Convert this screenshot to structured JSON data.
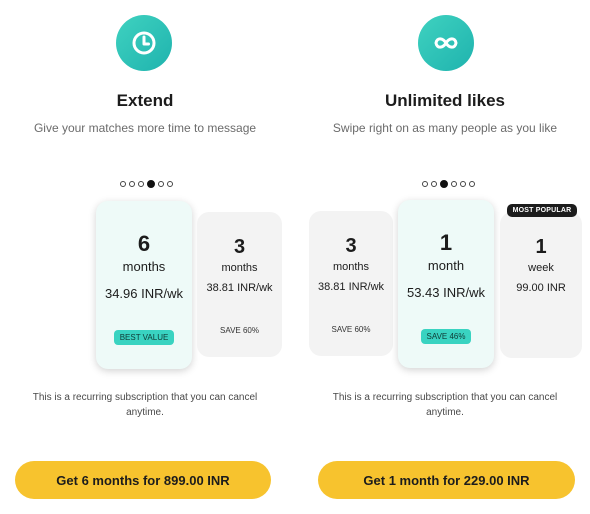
{
  "extend": {
    "icon": "clock-icon",
    "title": "Extend",
    "subtitle": "Give your matches more time to message",
    "plans": [
      {
        "qty": "6",
        "unit": "months",
        "price": "34.96 INR/wk",
        "badge": "BEST VALUE",
        "selected": true
      },
      {
        "qty": "3",
        "unit": "months",
        "price": "38.81 INR/wk",
        "badge": "SAVE 60%",
        "selected": false
      }
    ],
    "disclaimer": "This is a recurring subscription that you can cancel anytime.",
    "cta": "Get 6 months for 899.00 INR"
  },
  "unlimited": {
    "icon": "infinity-icon",
    "title": "Unlimited likes",
    "subtitle": "Swipe right on as many people as you like",
    "popular_tag": "MOST POPULAR",
    "plans": [
      {
        "qty": "3",
        "unit": "months",
        "price": "38.81 INR/wk",
        "badge": "SAVE 60%",
        "selected": false
      },
      {
        "qty": "1",
        "unit": "month",
        "price": "53.43 INR/wk",
        "badge": "SAVE 46%",
        "selected": true
      },
      {
        "qty": "1",
        "unit": "week",
        "price": "99.00 INR",
        "badge": "",
        "selected": false
      }
    ],
    "disclaimer": "This is a recurring subscription that you can cancel anytime.",
    "cta": "Get 1 month for 229.00 INR"
  },
  "colors": {
    "accent_teal": "#39d3c1",
    "cta_yellow": "#f7c32e",
    "selected_card": "#eefaf8"
  }
}
